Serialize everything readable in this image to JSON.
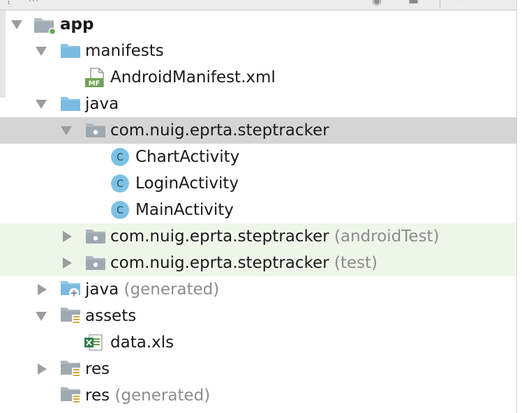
{
  "tree": {
    "app": {
      "label": "app"
    },
    "manifests": {
      "label": "manifests"
    },
    "android_manifest": {
      "label": "AndroidManifest.xml",
      "badge": "MF"
    },
    "java": {
      "label": "java"
    },
    "package_main": {
      "label": "com.nuig.eprta.steptracker"
    },
    "chart_activity": {
      "label": "ChartActivity",
      "badge": "C"
    },
    "login_activity": {
      "label": "LoginActivity",
      "badge": "C"
    },
    "main_activity": {
      "label": "MainActivity",
      "badge": "C"
    },
    "package_android_test": {
      "label": "com.nuig.eprta.steptracker",
      "suffix": "(androidTest)"
    },
    "package_test": {
      "label": "com.nuig.eprta.steptracker",
      "suffix": "(test)"
    },
    "java_generated": {
      "label": "java",
      "suffix": "(generated)"
    },
    "assets": {
      "label": "assets"
    },
    "data_xls": {
      "label": "data.xls"
    },
    "res": {
      "label": "res"
    },
    "res_generated": {
      "label": "res",
      "suffix": "(generated)"
    }
  },
  "colors": {
    "selected_row": "#d5d5d5",
    "test_row": "#eef6ea",
    "folder_blue": "#8cc6e6",
    "class_badge": "#7dc1e4",
    "suffix_text": "#8c8c8c"
  },
  "icons": {
    "folder": "folder-icon",
    "module": "module-folder-icon",
    "package": "package-folder-icon",
    "resource": "resource-folder-icon",
    "generated": "generated-folder-icon",
    "class": "class-icon",
    "manifest": "manifest-file-icon",
    "excel": "excel-file-icon"
  }
}
